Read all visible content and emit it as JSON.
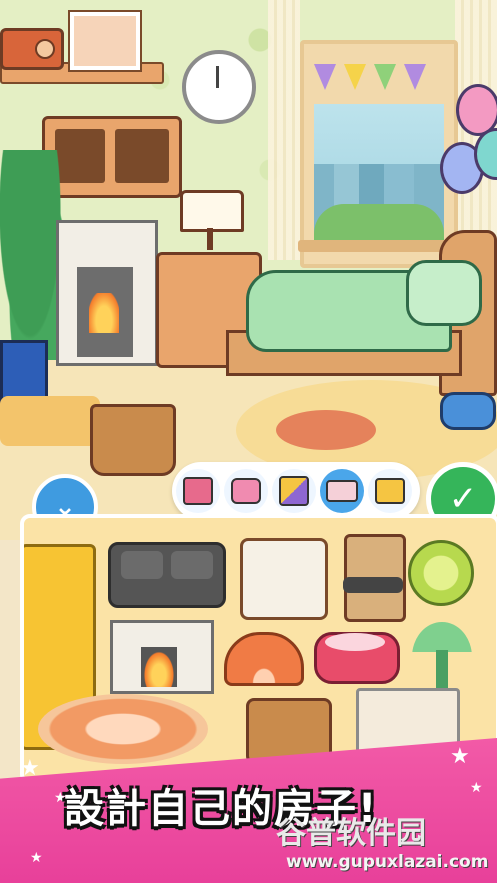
{
  "colors": {
    "banner_pink": "#e8409a",
    "confirm_green": "#35b55a",
    "collapse_blue": "#3f9be0",
    "panel_bg": "#fbe3a6"
  },
  "category_bar": {
    "items": [
      {
        "name": "kitchen",
        "icon": "kitchen-stove-icon"
      },
      {
        "name": "bathroom",
        "icon": "bathroom-sink-icon"
      },
      {
        "name": "livingroom",
        "icon": "stairs-room-icon"
      },
      {
        "name": "bedroom",
        "icon": "bed-icon",
        "selected": true
      },
      {
        "name": "outdoor",
        "icon": "cart-icon"
      }
    ]
  },
  "buttons": {
    "collapse_glyph": "⌄",
    "confirm_glyph": "✓"
  },
  "furniture_panel": {
    "items": [
      "fridge",
      "sofa",
      "armchair",
      "wooden-chair",
      "lime-rug",
      "fireplace",
      "orange-slice-rug",
      "pink-pouf",
      "green-lamp",
      "orange-round-rug",
      "wicker-basket",
      "white-cabinet"
    ]
  },
  "banner": {
    "title": "設計自己的房子!"
  },
  "watermark": {
    "line1": "谷普软件园",
    "line2": "www.gupuxlazai.com"
  }
}
